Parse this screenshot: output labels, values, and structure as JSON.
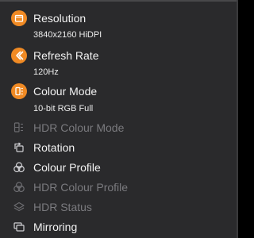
{
  "menu": {
    "items": [
      {
        "label": "Resolution",
        "value": "3840x2160 HiDPI",
        "icon": "display-resolution-icon",
        "enabled": true
      },
      {
        "label": "Refresh Rate",
        "value": "120Hz",
        "icon": "refresh-rate-icon",
        "enabled": true
      },
      {
        "label": "Colour Mode",
        "value": "10-bit RGB Full",
        "icon": "colour-mode-icon",
        "enabled": true
      },
      {
        "label": "HDR Colour Mode",
        "icon": "hdr-colour-mode-icon",
        "enabled": false
      },
      {
        "label": "Rotation",
        "icon": "rotation-icon",
        "enabled": true
      },
      {
        "label": "Colour Profile",
        "icon": "colour-profile-icon",
        "enabled": true
      },
      {
        "label": "HDR Colour Profile",
        "icon": "hdr-colour-profile-icon",
        "enabled": false
      },
      {
        "label": "HDR Status",
        "icon": "hdr-status-icon",
        "enabled": false
      },
      {
        "label": "Mirroring",
        "icon": "mirroring-icon",
        "enabled": true
      }
    ]
  },
  "colors": {
    "accent": "#f08a24",
    "background": "#2a2a2c",
    "text": "#f2f2f2",
    "disabled_text": "#7a7a7e"
  }
}
